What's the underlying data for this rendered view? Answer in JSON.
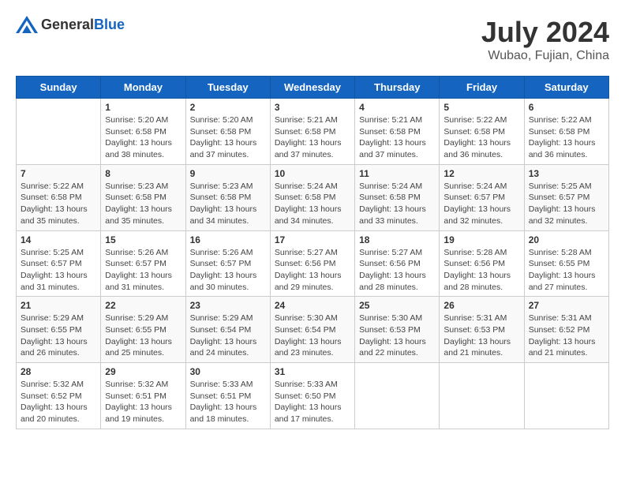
{
  "header": {
    "logo": {
      "text_general": "General",
      "text_blue": "Blue"
    },
    "title": "July 2024",
    "location": "Wubao, Fujian, China"
  },
  "weekdays": [
    "Sunday",
    "Monday",
    "Tuesday",
    "Wednesday",
    "Thursday",
    "Friday",
    "Saturday"
  ],
  "weeks": [
    [
      {
        "day": "",
        "info": ""
      },
      {
        "day": "1",
        "info": "Sunrise: 5:20 AM\nSunset: 6:58 PM\nDaylight: 13 hours\nand 38 minutes."
      },
      {
        "day": "2",
        "info": "Sunrise: 5:20 AM\nSunset: 6:58 PM\nDaylight: 13 hours\nand 37 minutes."
      },
      {
        "day": "3",
        "info": "Sunrise: 5:21 AM\nSunset: 6:58 PM\nDaylight: 13 hours\nand 37 minutes."
      },
      {
        "day": "4",
        "info": "Sunrise: 5:21 AM\nSunset: 6:58 PM\nDaylight: 13 hours\nand 37 minutes."
      },
      {
        "day": "5",
        "info": "Sunrise: 5:22 AM\nSunset: 6:58 PM\nDaylight: 13 hours\nand 36 minutes."
      },
      {
        "day": "6",
        "info": "Sunrise: 5:22 AM\nSunset: 6:58 PM\nDaylight: 13 hours\nand 36 minutes."
      }
    ],
    [
      {
        "day": "7",
        "info": "Sunrise: 5:22 AM\nSunset: 6:58 PM\nDaylight: 13 hours\nand 35 minutes."
      },
      {
        "day": "8",
        "info": "Sunrise: 5:23 AM\nSunset: 6:58 PM\nDaylight: 13 hours\nand 35 minutes."
      },
      {
        "day": "9",
        "info": "Sunrise: 5:23 AM\nSunset: 6:58 PM\nDaylight: 13 hours\nand 34 minutes."
      },
      {
        "day": "10",
        "info": "Sunrise: 5:24 AM\nSunset: 6:58 PM\nDaylight: 13 hours\nand 34 minutes."
      },
      {
        "day": "11",
        "info": "Sunrise: 5:24 AM\nSunset: 6:58 PM\nDaylight: 13 hours\nand 33 minutes."
      },
      {
        "day": "12",
        "info": "Sunrise: 5:24 AM\nSunset: 6:57 PM\nDaylight: 13 hours\nand 32 minutes."
      },
      {
        "day": "13",
        "info": "Sunrise: 5:25 AM\nSunset: 6:57 PM\nDaylight: 13 hours\nand 32 minutes."
      }
    ],
    [
      {
        "day": "14",
        "info": "Sunrise: 5:25 AM\nSunset: 6:57 PM\nDaylight: 13 hours\nand 31 minutes."
      },
      {
        "day": "15",
        "info": "Sunrise: 5:26 AM\nSunset: 6:57 PM\nDaylight: 13 hours\nand 31 minutes."
      },
      {
        "day": "16",
        "info": "Sunrise: 5:26 AM\nSunset: 6:57 PM\nDaylight: 13 hours\nand 30 minutes."
      },
      {
        "day": "17",
        "info": "Sunrise: 5:27 AM\nSunset: 6:56 PM\nDaylight: 13 hours\nand 29 minutes."
      },
      {
        "day": "18",
        "info": "Sunrise: 5:27 AM\nSunset: 6:56 PM\nDaylight: 13 hours\nand 28 minutes."
      },
      {
        "day": "19",
        "info": "Sunrise: 5:28 AM\nSunset: 6:56 PM\nDaylight: 13 hours\nand 28 minutes."
      },
      {
        "day": "20",
        "info": "Sunrise: 5:28 AM\nSunset: 6:55 PM\nDaylight: 13 hours\nand 27 minutes."
      }
    ],
    [
      {
        "day": "21",
        "info": "Sunrise: 5:29 AM\nSunset: 6:55 PM\nDaylight: 13 hours\nand 26 minutes."
      },
      {
        "day": "22",
        "info": "Sunrise: 5:29 AM\nSunset: 6:55 PM\nDaylight: 13 hours\nand 25 minutes."
      },
      {
        "day": "23",
        "info": "Sunrise: 5:29 AM\nSunset: 6:54 PM\nDaylight: 13 hours\nand 24 minutes."
      },
      {
        "day": "24",
        "info": "Sunrise: 5:30 AM\nSunset: 6:54 PM\nDaylight: 13 hours\nand 23 minutes."
      },
      {
        "day": "25",
        "info": "Sunrise: 5:30 AM\nSunset: 6:53 PM\nDaylight: 13 hours\nand 22 minutes."
      },
      {
        "day": "26",
        "info": "Sunrise: 5:31 AM\nSunset: 6:53 PM\nDaylight: 13 hours\nand 21 minutes."
      },
      {
        "day": "27",
        "info": "Sunrise: 5:31 AM\nSunset: 6:52 PM\nDaylight: 13 hours\nand 21 minutes."
      }
    ],
    [
      {
        "day": "28",
        "info": "Sunrise: 5:32 AM\nSunset: 6:52 PM\nDaylight: 13 hours\nand 20 minutes."
      },
      {
        "day": "29",
        "info": "Sunrise: 5:32 AM\nSunset: 6:51 PM\nDaylight: 13 hours\nand 19 minutes."
      },
      {
        "day": "30",
        "info": "Sunrise: 5:33 AM\nSunset: 6:51 PM\nDaylight: 13 hours\nand 18 minutes."
      },
      {
        "day": "31",
        "info": "Sunrise: 5:33 AM\nSunset: 6:50 PM\nDaylight: 13 hours\nand 17 minutes."
      },
      {
        "day": "",
        "info": ""
      },
      {
        "day": "",
        "info": ""
      },
      {
        "day": "",
        "info": ""
      }
    ]
  ]
}
